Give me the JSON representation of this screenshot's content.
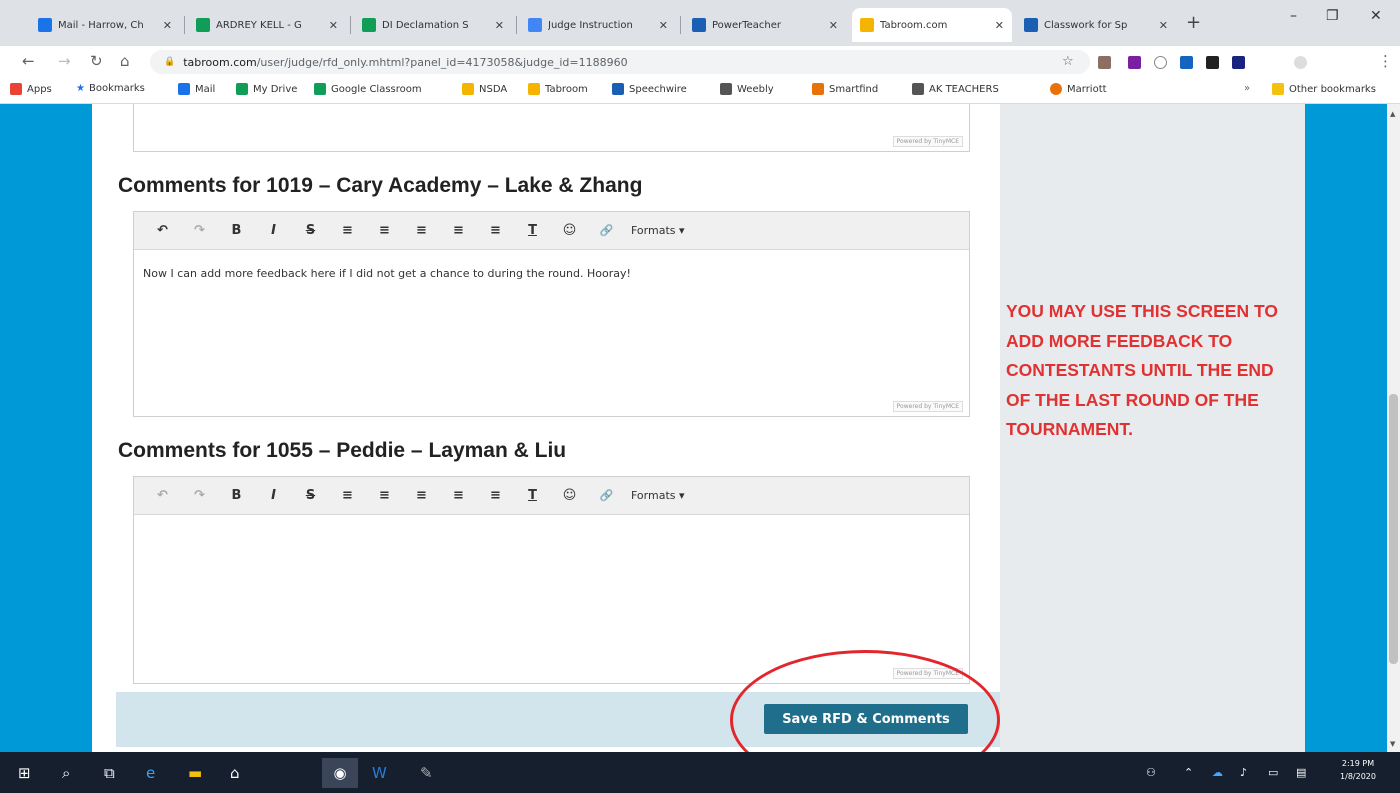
{
  "browser": {
    "tabs": [
      {
        "label": "Mail - Harrow, Ch",
        "color": "#1a73e8"
      },
      {
        "label": "ARDREY KELL - G",
        "color": "#0f9d58"
      },
      {
        "label": "DI Declamation S",
        "color": "#0f9d58"
      },
      {
        "label": "Judge Instruction",
        "color": "#4285f4"
      },
      {
        "label": "PowerTeacher",
        "color": "#1a5fb4"
      },
      {
        "label": "Tabroom.com",
        "color": "#f4b400"
      },
      {
        "label": "Classwork for Sp",
        "color": "#1a5fb4"
      }
    ],
    "new_tab": "+",
    "window_controls": {
      "minimize": "–",
      "maximize": "❐",
      "close": "✕"
    },
    "address": {
      "host": "tabroom.com",
      "path": "/user/judge/rfd_only.mhtml?panel_id=4173058&judge_id=1188960"
    },
    "bookmarks": [
      {
        "label": "Apps",
        "icon": "apps-icon",
        "color": "#ea4335"
      },
      {
        "label": "Bookmarks",
        "icon": "star-icon",
        "color": "#1a73e8"
      },
      {
        "label": "Mail",
        "icon": "mail-icon",
        "color": "#1a73e8"
      },
      {
        "label": "My Drive",
        "icon": "drive-icon",
        "color": "#0f9d58"
      },
      {
        "label": "Google Classroom",
        "icon": "classroom-icon",
        "color": "#0f9d58"
      },
      {
        "label": "NSDA",
        "icon": "nsda-icon",
        "color": "#f4b400"
      },
      {
        "label": "Tabroom",
        "icon": "tabroom-icon",
        "color": "#f4b400"
      },
      {
        "label": "Speechwire",
        "icon": "speechwire-icon",
        "color": "#1a5fb4"
      },
      {
        "label": "Weebly",
        "icon": "weebly-icon",
        "color": "#555555"
      },
      {
        "label": "Smartfind",
        "icon": "smartfind-icon",
        "color": "#e8710a"
      },
      {
        "label": "AK TEACHERS",
        "icon": "weebly-icon",
        "color": "#555555"
      },
      {
        "label": "Marriott",
        "icon": "marriott-icon",
        "color": "#e8710a"
      }
    ],
    "other_bookmarks": "Other bookmarks"
  },
  "page": {
    "editor1": {
      "heading": "Comments for 1019 – Cary Academy – Lake & Zhang",
      "body": "Now I can add more feedback here if I did not get a chance to during the round. Hooray!"
    },
    "editor2": {
      "heading": "Comments for 1055 – Peddie – Layman & Liu",
      "body": ""
    },
    "toolbar": {
      "undo": "↶",
      "redo": "↷",
      "bold": "B",
      "italic": "I",
      "strike": "S",
      "align_left": "≡",
      "align_center": "≡",
      "align_right": "≡",
      "indent": "≡",
      "outdent": "≡",
      "clear": "T",
      "emoji": "☺",
      "link": "🔗",
      "formats": "Formats ▾"
    },
    "powered_by": "Powered by TinyMCE",
    "save_button": "Save RFD & Comments",
    "annotation": "YOU MAY USE THIS SCREEN TO ADD MORE FEEDBACK TO CONTESTANTS UNTIL THE END OF THE LAST ROUND OF THE TOURNAMENT."
  },
  "taskbar": {
    "time": "2:19 PM",
    "date": "1/8/2020"
  },
  "colors": {
    "brand_blue": "#0099d8",
    "save_button": "#1f6e8c",
    "annotation_red": "#e03232"
  }
}
